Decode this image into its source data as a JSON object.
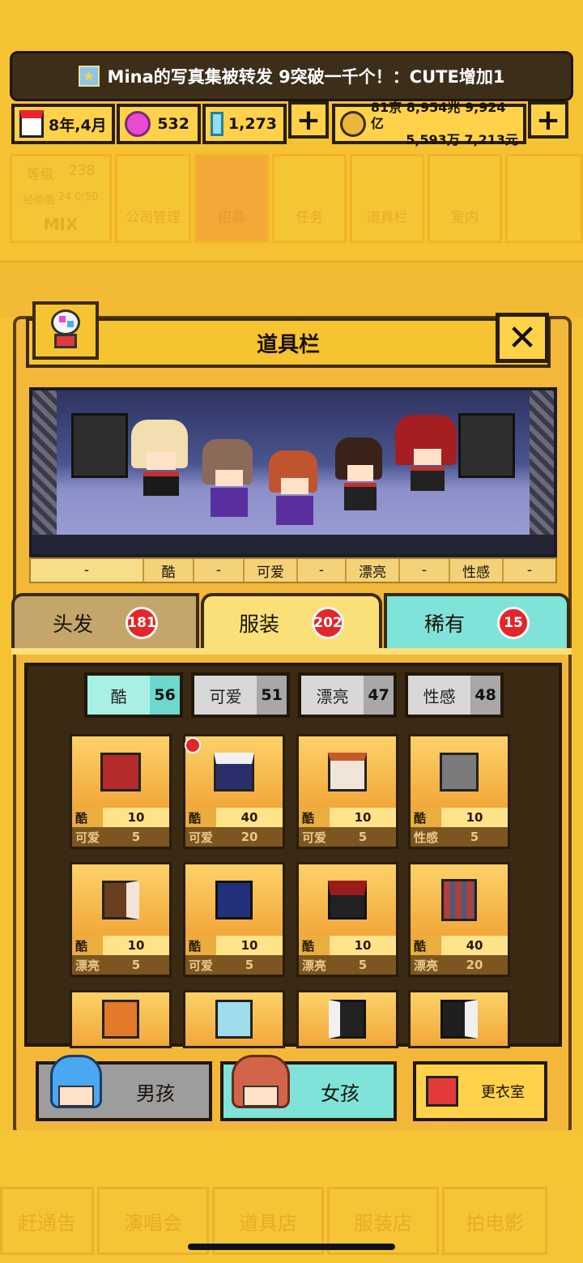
{
  "ticker": {
    "text": "Mina的写真集被转发 9突破一千个！：CUTE增加1"
  },
  "resources": {
    "date": "8年,4月",
    "gems": "532",
    "diamonds": "1,273",
    "money_line1": "81京 8,954兆 9,924亿",
    "money_line2": "5,593万 7,213元",
    "plus": "+"
  },
  "bg_menu": {
    "level_label": "等级",
    "level_value": "238",
    "exp_label": "经验值",
    "exp_value": "24.0/50",
    "group": "MIX",
    "items": [
      "公司管理",
      "招募",
      "任务",
      "道具栏",
      "室内"
    ]
  },
  "panel": {
    "title": "道具栏",
    "close": "✕"
  },
  "stats": [
    "-",
    "酷",
    "-",
    "可爱",
    "-",
    "漂亮",
    "-",
    "性感",
    "-"
  ],
  "tabs": [
    {
      "label": "头发",
      "count": "181"
    },
    {
      "label": "服装",
      "count": "202"
    },
    {
      "label": "稀有",
      "count": "15"
    }
  ],
  "filters": [
    {
      "label": "酷",
      "count": "56"
    },
    {
      "label": "可爱",
      "count": "51"
    },
    {
      "label": "漂亮",
      "count": "47"
    },
    {
      "label": "性感",
      "count": "48"
    }
  ],
  "items": [
    {
      "s1": "酷",
      "v1": "10",
      "s2": "可爱",
      "v2": "5",
      "color": "#b52a2a"
    },
    {
      "s1": "酷",
      "v1": "40",
      "s2": "可爱",
      "v2": "20",
      "color": "#2a2f6b"
    },
    {
      "s1": "酷",
      "v1": "10",
      "s2": "可爱",
      "v2": "5",
      "color": "#f0e5d8"
    },
    {
      "s1": "酷",
      "v1": "10",
      "s2": "性感",
      "v2": "5",
      "color": "#7b7b7b"
    },
    {
      "s1": "酷",
      "v1": "10",
      "s2": "漂亮",
      "v2": "5",
      "color": "#6b3e20"
    },
    {
      "s1": "酷",
      "v1": "10",
      "s2": "可爱",
      "v2": "5",
      "color": "#23307a"
    },
    {
      "s1": "酷",
      "v1": "10",
      "s2": "漂亮",
      "v2": "5",
      "color": "#9b1c1c"
    },
    {
      "s1": "酷",
      "v1": "40",
      "s2": "漂亮",
      "v2": "20",
      "color": "#b0403a"
    },
    {
      "color": "#e27a2a"
    },
    {
      "color": "#9fdcec"
    },
    {
      "color": "#222222"
    },
    {
      "color": "#1f1f1f"
    }
  ],
  "gender": {
    "boy": "男孩",
    "girl": "女孩",
    "dressing": "更衣室"
  },
  "bottom_nav": [
    "赶通告",
    "演唱会",
    "道具店",
    "服装店",
    "拍电影"
  ]
}
